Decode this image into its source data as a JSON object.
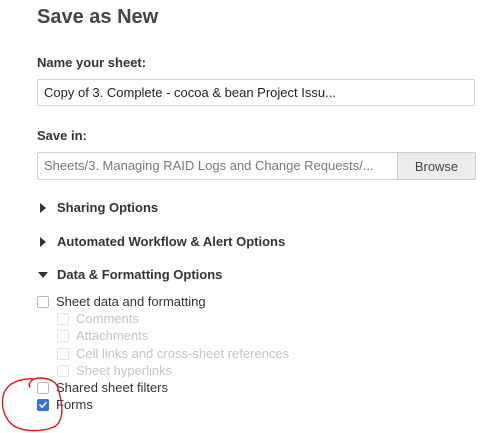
{
  "title": "Save as New",
  "name_field": {
    "label": "Name your sheet:",
    "value": "Copy of 3. Complete - cocoa & bean Project Issu..."
  },
  "save_in": {
    "label": "Save in:",
    "path": "Sheets/3. Managing RAID Logs and Change Requests/...",
    "browse_label": "Browse"
  },
  "sections": {
    "sharing": "Sharing Options",
    "workflow": "Automated Workflow & Alert Options",
    "data_formatting": "Data & Formatting Options"
  },
  "options": {
    "sheet_data": {
      "label": "Sheet data and formatting",
      "checked": false
    },
    "comments": {
      "label": "Comments",
      "checked": false,
      "disabled": true
    },
    "attachments": {
      "label": "Attachments",
      "checked": false,
      "disabled": true
    },
    "cell_links": {
      "label": "Cell links and cross-sheet references",
      "checked": false,
      "disabled": true
    },
    "sheet_hyperlinks": {
      "label": "Sheet hyperlinks",
      "checked": false,
      "disabled": true
    },
    "shared_filters": {
      "label": "Shared sheet filters",
      "checked": false
    },
    "forms": {
      "label": "Forms",
      "checked": true
    }
  },
  "colors": {
    "checkbox_checked": "#2f72d8",
    "annotation": "#e01a1a"
  }
}
